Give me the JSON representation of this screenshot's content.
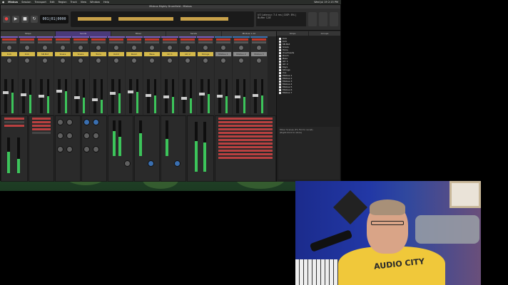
{
  "menubar": {
    "app": "Mixbus",
    "items": [
      "Session",
      "Transport",
      "Edit",
      "Region",
      "Track",
      "View",
      "Window",
      "Help"
    ],
    "clock": "Wed Jul 19 2:15 PM"
  },
  "window_title": "Mixbus Mighty Drumfield - Mixbus",
  "toolbar": {
    "counter": "001|01|0000",
    "info": "I/O Latency: 7.4 ms | DSP: 8% | Buffer 128"
  },
  "mixer_tabs": [
    "Strips",
    "Sends",
    "Mixer",
    "Sends",
    "Mixbus 1-12"
  ],
  "channels": [
    {
      "name": "Kick",
      "level": 0.6
    },
    {
      "name": "Kick",
      "level": 0.55
    },
    {
      "name": "SN Bot",
      "level": 0.5
    },
    {
      "name": "Snare",
      "level": 0.65
    },
    {
      "name": "Snare",
      "level": 0.45
    },
    {
      "name": "Toms",
      "level": 0.4
    },
    {
      "name": "Ovhd",
      "level": 0.58
    },
    {
      "name": "Room",
      "level": 0.62
    },
    {
      "name": "Bass",
      "level": 0.52
    },
    {
      "name": "Gtr 1",
      "level": 0.48
    },
    {
      "name": "Gtr 2",
      "level": 0.44
    },
    {
      "name": "Strings",
      "level": 0.56
    },
    {
      "name": "Mixbus 1",
      "level": 0.5
    },
    {
      "name": "Mixbus 2",
      "level": 0.47
    },
    {
      "name": "Mixbus 3",
      "level": 0.53
    }
  ],
  "right_tabs": [
    "Strips",
    "Groups"
  ],
  "strips_list": [
    "Kick",
    "Kick",
    "SN Bot",
    "Snare",
    "Toms",
    "Overheads",
    "Room",
    "Bass",
    "Gtr 1",
    "Gtr 2",
    "Keys",
    "Strings",
    "Vox",
    "Mixbus 1",
    "Mixbus 2",
    "Mixbus 3",
    "Mixbus 4",
    "Mixbus 5",
    "Mixbus 6",
    "Mixbus 7"
  ],
  "notes": {
    "title": "Mixer Scenes (F1-F12 to recall)",
    "hint": "(Right-Click to store)"
  },
  "webcam": {
    "shirt_text": "AUDIO CITY"
  }
}
